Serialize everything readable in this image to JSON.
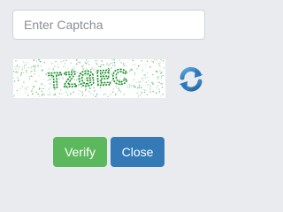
{
  "captcha": {
    "input_placeholder": "Enter Captcha",
    "input_value": "",
    "image_text": "TZGEC",
    "text_color": "#1a8f2a",
    "noise_color": "#2e9b3a",
    "refresh_icon": "refresh-icon"
  },
  "actions": {
    "verify_label": "Verify",
    "close_label": "Close",
    "verify_color": "#5cb85c",
    "close_color": "#337ab7"
  }
}
